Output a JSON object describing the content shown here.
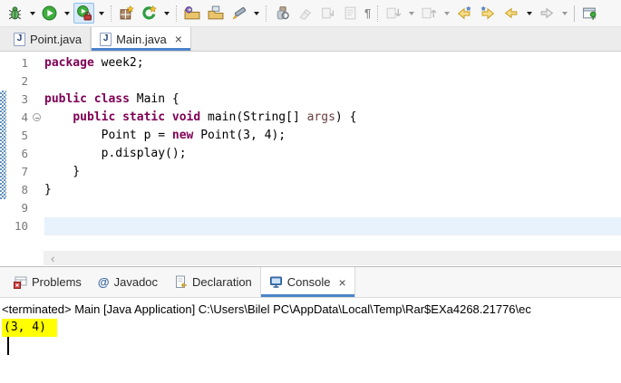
{
  "glyphs": {
    "close": "×",
    "pilcrow": "¶",
    "chevron_left": "‹",
    "java_file": "J",
    "javadoc_at": "@"
  },
  "colors": {
    "keyword": "#7f0055",
    "parameter": "#6a3e3e",
    "tab_underline": "#4c84c9",
    "current_line_bg": "#e8f2fd",
    "output_highlight": "#ffff00",
    "change_bar_blue": "#6292bf",
    "line_number": "#787878"
  },
  "toolbar": {
    "buttons": [
      "debug",
      "run",
      "run-coverage",
      "new-java-project",
      "new-wizard",
      "import",
      "export",
      "format-pen",
      "search",
      "clear",
      "link-with-editor",
      "show-source",
      "show-whitespace",
      "next-annotation",
      "previous-annotation",
      "last-edit-location",
      "next-edit-location",
      "back",
      "forward",
      "pin-editor"
    ]
  },
  "editor_tabs": [
    {
      "label": "Point.java",
      "active": false
    },
    {
      "label": "Main.java",
      "active": true,
      "closable": true
    }
  ],
  "editor": {
    "lines": [
      {
        "num": "1",
        "tokens": [
          {
            "t": "package",
            "s": "kw"
          },
          {
            "t": " week2;",
            "s": "pl"
          }
        ]
      },
      {
        "num": "2",
        "tokens": []
      },
      {
        "num": "3",
        "changed": true,
        "tokens": [
          {
            "t": "public class",
            "s": "kw"
          },
          {
            "t": " Main {",
            "s": "pl"
          }
        ]
      },
      {
        "num": "4",
        "changed": true,
        "fold": true,
        "tokens": [
          {
            "t": "    ",
            "s": "pl"
          },
          {
            "t": "public static void",
            "s": "kw"
          },
          {
            "t": " main(String[] ",
            "s": "pl"
          },
          {
            "t": "args",
            "s": "prm"
          },
          {
            "t": ") {",
            "s": "pl"
          }
        ]
      },
      {
        "num": "5",
        "changed": true,
        "tokens": [
          {
            "t": "        Point p = ",
            "s": "pl"
          },
          {
            "t": "new",
            "s": "kw"
          },
          {
            "t": " Point(3, 4);",
            "s": "pl"
          }
        ]
      },
      {
        "num": "6",
        "changed": true,
        "tokens": [
          {
            "t": "        p.display();",
            "s": "pl"
          }
        ]
      },
      {
        "num": "7",
        "changed": true,
        "tokens": [
          {
            "t": "    }",
            "s": "pl"
          }
        ]
      },
      {
        "num": "8",
        "changed": true,
        "tokens": [
          {
            "t": "}",
            "s": "pl"
          }
        ]
      },
      {
        "num": "9",
        "tokens": []
      },
      {
        "num": "10",
        "current": true,
        "tokens": []
      }
    ]
  },
  "console_panel": {
    "tabs": [
      {
        "label": "Problems"
      },
      {
        "label": "Javadoc"
      },
      {
        "label": "Declaration"
      },
      {
        "label": "Console",
        "active": true,
        "closable": true
      }
    ],
    "header": "<terminated> Main [Java Application] C:\\Users\\Bilel PC\\AppData\\Local\\Temp\\Rar$EXa4268.21776\\ec",
    "output": "(3, 4)"
  }
}
